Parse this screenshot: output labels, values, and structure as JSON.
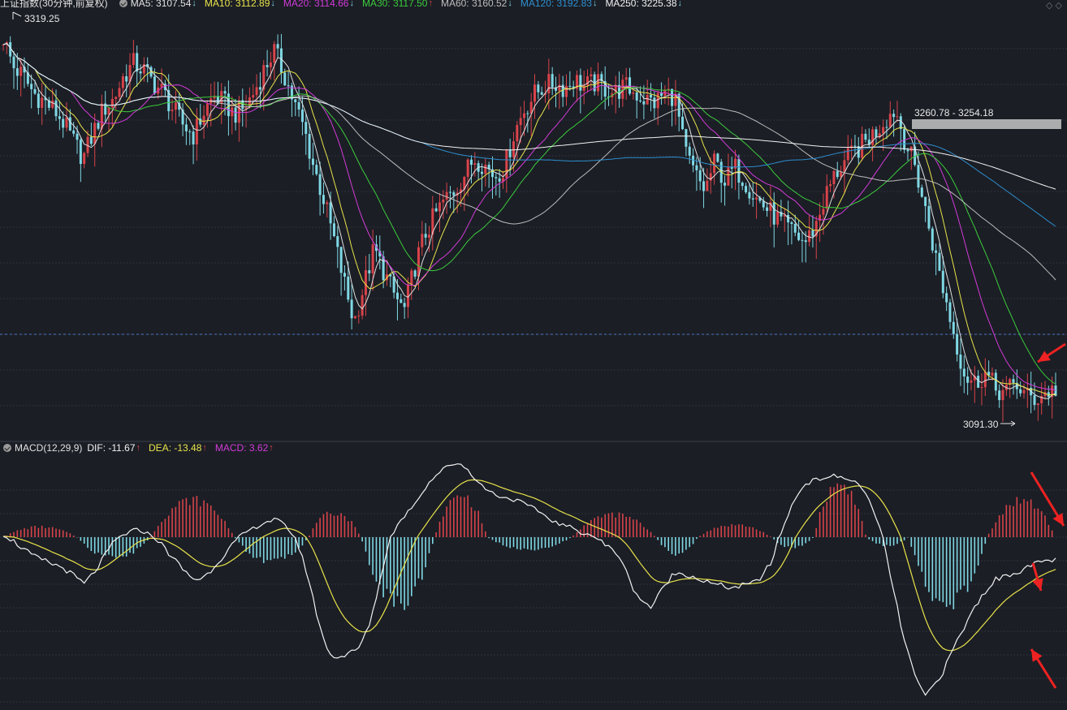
{
  "title": "上证指数(30分钟,前复权)",
  "main_legend": [
    {
      "label": "MA5: 3107.54",
      "color": "#e0e0e0",
      "dir": "down"
    },
    {
      "label": "MA10: 3112.89",
      "color": "#e8e34a",
      "dir": "down"
    },
    {
      "label": "MA20: 3114.66",
      "color": "#d23bd8",
      "dir": "down"
    },
    {
      "label": "MA30: 3117.50",
      "color": "#3ccc3c",
      "dir": "up"
    },
    {
      "label": "MA60: 3160.52",
      "color": "#bdbdbd",
      "dir": "down"
    },
    {
      "label": "MA120: 3192.83",
      "color": "#2e8fd0",
      "dir": "down"
    },
    {
      "label": "MA250: 3225.38",
      "color": "#f2f2f2",
      "dir": "down"
    }
  ],
  "macd_legend": {
    "name": "MACD(12,29,9)",
    "items": [
      {
        "label": "DIF: -11.67",
        "color": "#f2f2f2",
        "dir": "up"
      },
      {
        "label": "DEA: -13.48",
        "color": "#e8e34a",
        "dir": "up"
      },
      {
        "label": "MACD: 3.62",
        "color": "#d23bd8",
        "dir": "up"
      }
    ]
  },
  "colors": {
    "up": "#d8434a",
    "down": "#7fd8e4",
    "grid": "#2f333d",
    "dif": "#f2f2f2",
    "dea": "#e8e34a",
    "annotation_arrow": "#ee2222",
    "range_box": "#cfcfcf"
  },
  "chart_data": {
    "type": "candlestick-with-macd",
    "price_annotations": {
      "high": "3319.25",
      "low": "3091.30",
      "range_label": "3260.78 - 3254.18"
    },
    "price_range": [
      3080,
      3330
    ],
    "price_path": [
      3320,
      3302,
      3296,
      3286,
      3281,
      3276,
      3268,
      3256,
      3246,
      3262,
      3276,
      3282,
      3296,
      3304,
      3300,
      3292,
      3286,
      3275,
      3266,
      3260,
      3274,
      3284,
      3280,
      3273,
      3276,
      3286,
      3300,
      3312,
      3298,
      3280,
      3264,
      3240,
      3220,
      3196,
      3170,
      3145,
      3168,
      3190,
      3176,
      3162,
      3152,
      3178,
      3198,
      3210,
      3220,
      3226,
      3236,
      3246,
      3242,
      3235,
      3240,
      3262,
      3276,
      3285,
      3290,
      3292,
      3289,
      3294,
      3290,
      3292,
      3289,
      3286,
      3290,
      3286,
      3282,
      3280,
      3286,
      3284,
      3250,
      3236,
      3226,
      3244,
      3232,
      3240,
      3232,
      3222,
      3216,
      3210,
      3204,
      3199,
      3194,
      3204,
      3222,
      3236,
      3244,
      3250,
      3256,
      3262,
      3270,
      3276,
      3256,
      3240,
      3214,
      3186,
      3160,
      3134,
      3112,
      3108,
      3114,
      3104,
      3102,
      3108,
      3100,
      3098,
      3102,
      3104
    ],
    "macd_path": [
      2,
      -2,
      -6,
      -10,
      -12,
      -14,
      -16,
      -20,
      -24,
      -18,
      -10,
      -2,
      2,
      6,
      4,
      0,
      -6,
      -12,
      -18,
      -22,
      -20,
      -14,
      -8,
      -2,
      4,
      8,
      12,
      14,
      8,
      -2,
      -18,
      -40,
      -58,
      -62,
      -60,
      -58,
      -48,
      -28,
      -4,
      10,
      20,
      30,
      42,
      50,
      56,
      58,
      52,
      42,
      36,
      32,
      30,
      28,
      24,
      20,
      14,
      10,
      8,
      4,
      2,
      -2,
      -6,
      -10,
      -24,
      -32,
      -36,
      -28,
      -20,
      -18,
      -20,
      -22,
      -24,
      -25,
      -26,
      -25,
      -24,
      -20,
      -12,
      6,
      26,
      40,
      44,
      46,
      48,
      46,
      44,
      38,
      20,
      -2,
      -28,
      -52,
      -70,
      -82,
      -76,
      -68,
      -56,
      -46,
      -36,
      -28,
      -22,
      -20,
      -18,
      -16,
      -14,
      -12,
      -11.67
    ],
    "histogram": [
      {
        "from": 0.0,
        "to": 0.07,
        "amp": 0.25
      },
      {
        "from": 0.07,
        "to": 0.14,
        "amp": -0.5
      },
      {
        "from": 0.14,
        "to": 0.22,
        "amp": 0.9
      },
      {
        "from": 0.22,
        "to": 0.29,
        "amp": -0.6
      },
      {
        "from": 0.29,
        "to": 0.34,
        "amp": 0.6
      },
      {
        "from": 0.34,
        "to": 0.41,
        "amp": -1.6
      },
      {
        "from": 0.41,
        "to": 0.46,
        "amp": 1.0
      },
      {
        "from": 0.46,
        "to": 0.54,
        "amp": -0.3
      },
      {
        "from": 0.54,
        "to": 0.62,
        "amp": 0.55
      },
      {
        "from": 0.62,
        "to": 0.66,
        "amp": -0.4
      },
      {
        "from": 0.66,
        "to": 0.73,
        "amp": 0.3
      },
      {
        "from": 0.73,
        "to": 0.77,
        "amp": -0.25
      },
      {
        "from": 0.77,
        "to": 0.82,
        "amp": 1.3
      },
      {
        "from": 0.82,
        "to": 0.86,
        "amp": -0.2
      },
      {
        "from": 0.86,
        "to": 0.935,
        "amp": -1.6
      },
      {
        "from": 0.935,
        "to": 1.0,
        "amp": 0.9
      }
    ]
  }
}
